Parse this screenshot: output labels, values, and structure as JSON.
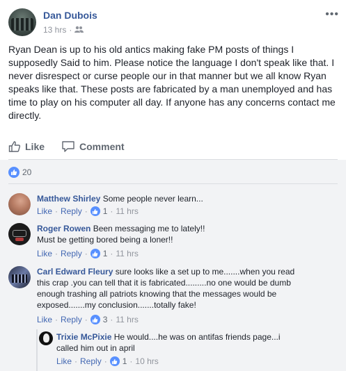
{
  "post": {
    "author": "Dan Dubois",
    "time": "13 hrs",
    "separator": "·",
    "body": "Ryan Dean is up to his old antics making fake PM posts of things I supposedly Said to him. Please notice the language I don't speak like that. I never disrespect or curse people our in that manner but we all know Ryan speaks like that. These posts are fabricated by a man unemployed and has time to play on his computer all day. If anyone has any concerns contact me directly.",
    "audience_icon": "friends-icon",
    "more_label": "•••"
  },
  "actions": {
    "like_label": "Like",
    "comment_label": "Comment"
  },
  "reactions": {
    "count": "20"
  },
  "comments": [
    {
      "name": "Matthew Shirley",
      "text": "Some people never learn...",
      "like": "Like",
      "reply": "Reply",
      "sep": "·",
      "likes": "1",
      "time": "11 hrs"
    },
    {
      "name": "Roger Rowen",
      "text": "Been messaging me to lately!!",
      "text2": "Must be getting bored being a loner!!",
      "like": "Like",
      "reply": "Reply",
      "sep": "·",
      "likes": "1",
      "time": "11 hrs"
    },
    {
      "name": "Carl Edward Fleury",
      "text": "sure looks like a set up to me.......when you read",
      "text2": "this crap .you can tell that it is fabricated.........no one would be dumb",
      "text3": "enough trashing all patriots knowing that the messages would be",
      "text4": "exposed.......my conclusion.......totally fake!",
      "like": "Like",
      "reply": "Reply",
      "sep": "·",
      "likes": "3",
      "time": "11 hrs"
    },
    {
      "name": "Trixie McPixie",
      "text": "He would....he was on antifas friends page...i",
      "text2": "called him out in april",
      "like": "Like",
      "reply": "Reply",
      "sep": "·",
      "likes": "1",
      "time": "10 hrs"
    }
  ],
  "colors": {
    "link": "#365899",
    "action": "#4267b2",
    "like_blue": "#5890ff",
    "meta_gray": "#90949c",
    "comment_bg": "#f2f3f5"
  }
}
